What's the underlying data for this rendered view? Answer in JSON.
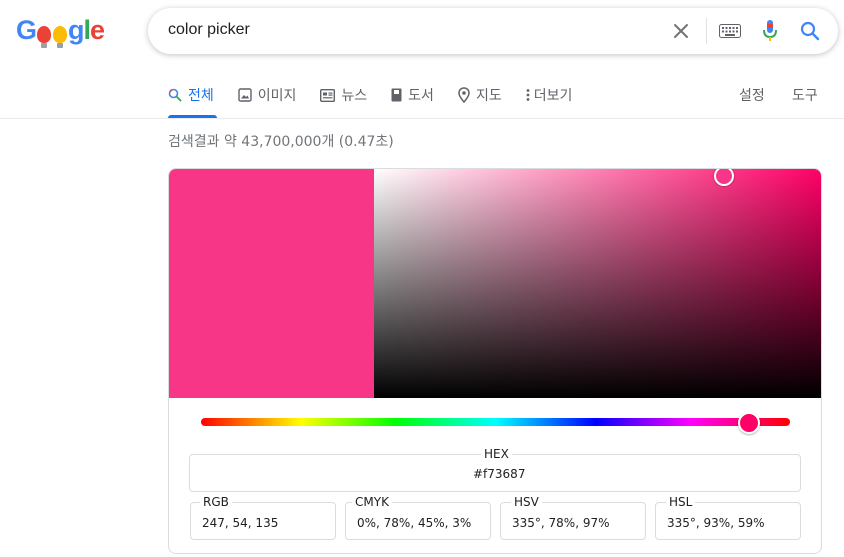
{
  "logo": {
    "letters": [
      "G",
      "g",
      "l",
      "e"
    ]
  },
  "search": {
    "query": "color picker"
  },
  "tabs": [
    {
      "label": "전체",
      "icon": "search-icon",
      "active": true
    },
    {
      "label": "이미지",
      "icon": "image-icon"
    },
    {
      "label": "뉴스",
      "icon": "news-icon"
    },
    {
      "label": "도서",
      "icon": "book-icon"
    },
    {
      "label": "지도",
      "icon": "map-pin-icon"
    },
    {
      "label": "더보기",
      "icon": "more-vert-icon"
    }
  ],
  "right_links": {
    "settings": "설정",
    "tools": "도구"
  },
  "result_stats": "검색결과 약 43,700,000개 (0.47초)",
  "picker": {
    "selected_color": "#f73687",
    "hue_color": "#ff0066",
    "saturation_pct": 78,
    "value_pct": 97,
    "hue_deg": 335,
    "hex_label": "HEX",
    "hex_value": "#f73687",
    "rgb_label": "RGB",
    "rgb_value": "247, 54, 135",
    "cmyk_label": "CMYK",
    "cmyk_value": "0%, 78%, 45%, 3%",
    "hsv_label": "HSV",
    "hsv_value": "335°, 78%, 97%",
    "hsl_label": "HSL",
    "hsl_value": "335°, 93%, 59%"
  },
  "colors": {
    "accent": "#1a73e8",
    "tab_text": "#5f6368",
    "border": "#dadce0"
  }
}
